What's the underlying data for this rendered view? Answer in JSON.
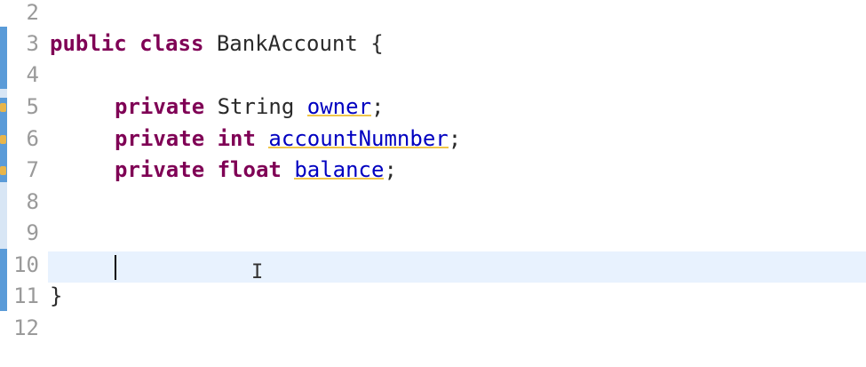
{
  "editor": {
    "line_numbers": [
      "2",
      "3",
      "4",
      "5",
      "6",
      "7",
      "8",
      "9",
      "10",
      "11",
      "12"
    ],
    "lines": {
      "l3": {
        "kw1": "public",
        "kw2": "class",
        "name": "BankAccount",
        "brace": "{"
      },
      "l5": {
        "kw": "private",
        "type": "String",
        "field": "owner",
        "semi": ";"
      },
      "l6": {
        "kw": "private",
        "type": "int",
        "field": "accountNumnber",
        "semi": ";"
      },
      "l7": {
        "kw": "private",
        "type": "float",
        "field": "balance",
        "semi": ";"
      },
      "l11": {
        "brace": "}"
      }
    }
  },
  "colors": {
    "keyword": "#7f0055",
    "field": "#0000c0",
    "warning_underline": "#f0c64a",
    "current_line": "#e8f2fe",
    "change_bar": "#5a9bd8"
  },
  "icons": {
    "cursor": "text-cursor-icon",
    "warning": "warning-marker-icon"
  }
}
